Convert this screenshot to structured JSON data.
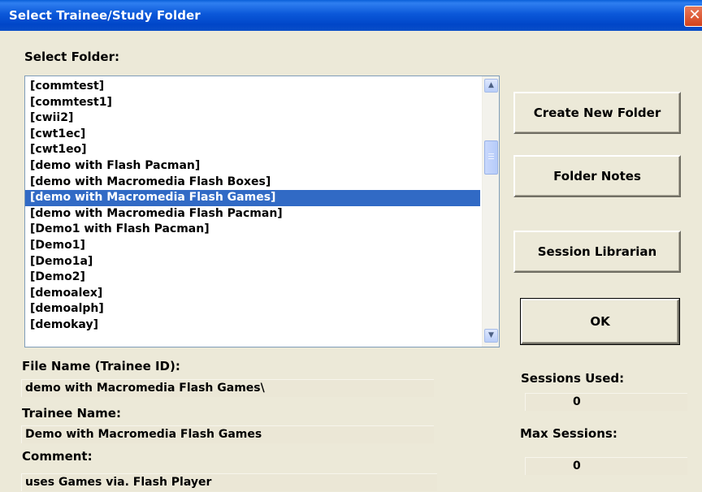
{
  "window": {
    "title": "Select Trainee/Study Folder",
    "close_glyph": "✕"
  },
  "folder_list": {
    "label": "Select Folder:",
    "items": [
      "[commtest]",
      "[commtest1]",
      "[cwii2]",
      "[cwt1ec]",
      "[cwt1eo]",
      "[demo with Flash Pacman]",
      "[demo with Macromedia Flash Boxes]",
      "[demo with Macromedia Flash Games]",
      "[demo with Macromedia Flash Pacman]",
      "[Demo1 with Flash Pacman]",
      "[Demo1]",
      "[Demo1a]",
      "[Demo2]",
      "[demoalex]",
      "[demoalph]",
      "[demokay]"
    ],
    "selected_item": "[demo with Macromedia Flash Games]",
    "scroll_up_glyph": "▲",
    "scroll_down_glyph": "▼"
  },
  "buttons": {
    "create_new_folder": "Create New Folder",
    "folder_notes": "Folder Notes",
    "session_librarian": "Session Librarian",
    "ok": "OK"
  },
  "fields": {
    "file_name_label": "File Name (Trainee ID):",
    "file_name_value": "demo with Macromedia Flash Games\\",
    "trainee_name_label": "Trainee Name:",
    "trainee_name_value": "Demo with Macromedia Flash Games",
    "comment_label": "Comment:",
    "comment_value": "uses Games via. Flash Player",
    "sessions_used_label": "Sessions Used:",
    "sessions_used_value": "0",
    "max_sessions_label": "Max Sessions:",
    "max_sessions_value": "0"
  },
  "colors": {
    "titlebar": "#0b58d9",
    "selection": "#316ac5",
    "dialog_bg": "#ece9d8"
  }
}
